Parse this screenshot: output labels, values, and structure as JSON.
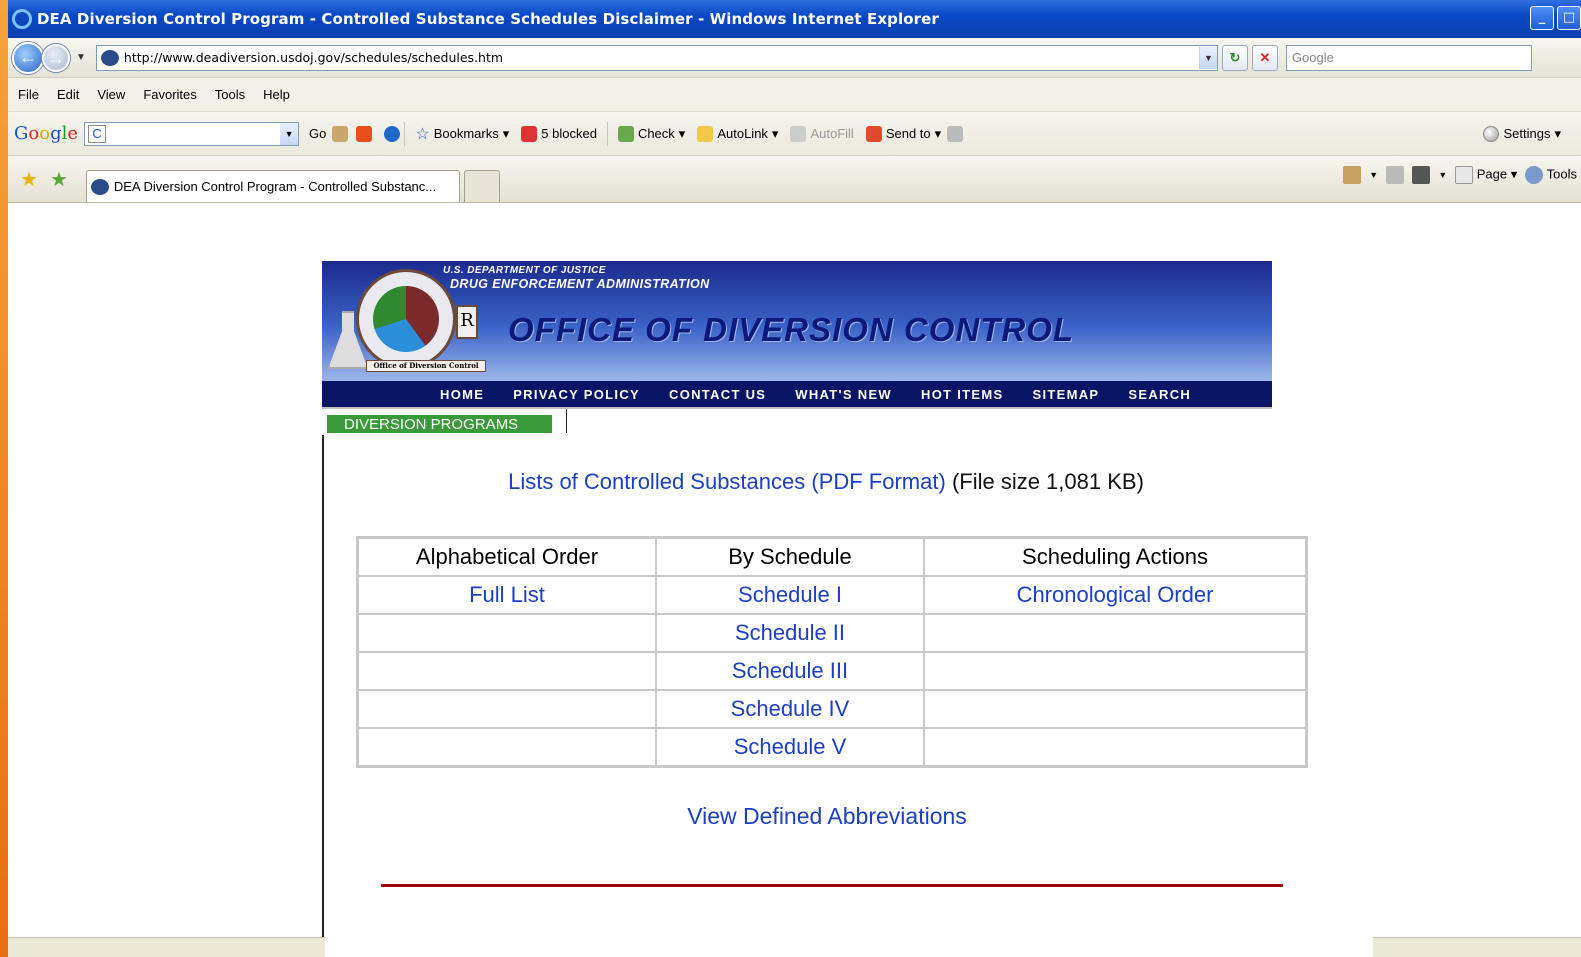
{
  "window": {
    "title": "DEA Diversion Control Program - Controlled Substance Schedules Disclaimer - Windows Internet Explorer"
  },
  "addressbar": {
    "url": "http://www.deadiversion.usdoj.gov/schedules/schedules.htm",
    "search_placeholder": "Google"
  },
  "menu": [
    "File",
    "Edit",
    "View",
    "Favorites",
    "Tools",
    "Help"
  ],
  "google_toolbar": {
    "go": "Go",
    "bookmarks": "Bookmarks",
    "blocked": "5 blocked",
    "check": "Check",
    "autolink": "AutoLink",
    "autofill": "AutoFill",
    "sendto": "Send to",
    "settings": "Settings"
  },
  "tabs": {
    "active_title": "DEA Diversion Control Program - Controlled Substanc..."
  },
  "commandbar": {
    "page": "Page",
    "tools": "Tools"
  },
  "banner": {
    "doj": "U.S. DEPARTMENT OF JUSTICE",
    "dea": "DRUG ENFORCEMENT ADMINISTRATION",
    "office": "OFFICE OF DIVERSION CONTROL",
    "seal_label": "Office of Diversion Control"
  },
  "nav": [
    "HOME",
    "PRIVACY POLICY",
    "CONTACT US",
    "WHAT'S NEW",
    "HOT ITEMS",
    "SITEMAP",
    "SEARCH"
  ],
  "diversion_tab": "DIVERSION PROGRAMS",
  "content": {
    "lists_link": "Lists of Controlled Substances (PDF Format)",
    "file_size": "(File size 1,081 KB)",
    "table": {
      "headers": [
        "Alphabetical Order",
        "By Schedule",
        "Scheduling Actions"
      ],
      "rows": [
        [
          "Full List",
          "Schedule I",
          "Chronological Order"
        ],
        [
          "",
          "Schedule II",
          ""
        ],
        [
          "",
          "Schedule III",
          ""
        ],
        [
          "",
          "Schedule IV",
          ""
        ],
        [
          "",
          "Schedule V",
          ""
        ]
      ]
    },
    "abbrev_link": "View Defined Abbreviations"
  }
}
